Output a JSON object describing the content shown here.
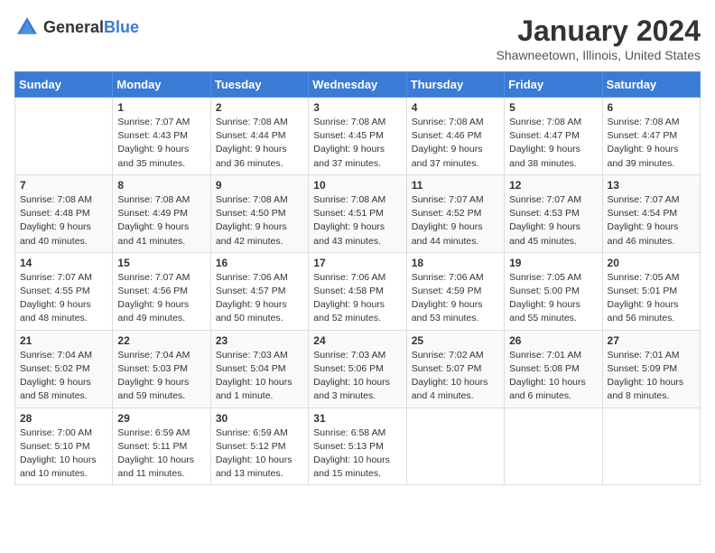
{
  "header": {
    "logo_general": "General",
    "logo_blue": "Blue",
    "title": "January 2024",
    "location": "Shawneetown, Illinois, United States"
  },
  "days_of_week": [
    "Sunday",
    "Monday",
    "Tuesday",
    "Wednesday",
    "Thursday",
    "Friday",
    "Saturday"
  ],
  "weeks": [
    [
      {
        "day": "",
        "info": ""
      },
      {
        "day": "1",
        "info": "Sunrise: 7:07 AM\nSunset: 4:43 PM\nDaylight: 9 hours\nand 35 minutes."
      },
      {
        "day": "2",
        "info": "Sunrise: 7:08 AM\nSunset: 4:44 PM\nDaylight: 9 hours\nand 36 minutes."
      },
      {
        "day": "3",
        "info": "Sunrise: 7:08 AM\nSunset: 4:45 PM\nDaylight: 9 hours\nand 37 minutes."
      },
      {
        "day": "4",
        "info": "Sunrise: 7:08 AM\nSunset: 4:46 PM\nDaylight: 9 hours\nand 37 minutes."
      },
      {
        "day": "5",
        "info": "Sunrise: 7:08 AM\nSunset: 4:47 PM\nDaylight: 9 hours\nand 38 minutes."
      },
      {
        "day": "6",
        "info": "Sunrise: 7:08 AM\nSunset: 4:47 PM\nDaylight: 9 hours\nand 39 minutes."
      }
    ],
    [
      {
        "day": "7",
        "info": "Sunrise: 7:08 AM\nSunset: 4:48 PM\nDaylight: 9 hours\nand 40 minutes."
      },
      {
        "day": "8",
        "info": "Sunrise: 7:08 AM\nSunset: 4:49 PM\nDaylight: 9 hours\nand 41 minutes."
      },
      {
        "day": "9",
        "info": "Sunrise: 7:08 AM\nSunset: 4:50 PM\nDaylight: 9 hours\nand 42 minutes."
      },
      {
        "day": "10",
        "info": "Sunrise: 7:08 AM\nSunset: 4:51 PM\nDaylight: 9 hours\nand 43 minutes."
      },
      {
        "day": "11",
        "info": "Sunrise: 7:07 AM\nSunset: 4:52 PM\nDaylight: 9 hours\nand 44 minutes."
      },
      {
        "day": "12",
        "info": "Sunrise: 7:07 AM\nSunset: 4:53 PM\nDaylight: 9 hours\nand 45 minutes."
      },
      {
        "day": "13",
        "info": "Sunrise: 7:07 AM\nSunset: 4:54 PM\nDaylight: 9 hours\nand 46 minutes."
      }
    ],
    [
      {
        "day": "14",
        "info": "Sunrise: 7:07 AM\nSunset: 4:55 PM\nDaylight: 9 hours\nand 48 minutes."
      },
      {
        "day": "15",
        "info": "Sunrise: 7:07 AM\nSunset: 4:56 PM\nDaylight: 9 hours\nand 49 minutes."
      },
      {
        "day": "16",
        "info": "Sunrise: 7:06 AM\nSunset: 4:57 PM\nDaylight: 9 hours\nand 50 minutes."
      },
      {
        "day": "17",
        "info": "Sunrise: 7:06 AM\nSunset: 4:58 PM\nDaylight: 9 hours\nand 52 minutes."
      },
      {
        "day": "18",
        "info": "Sunrise: 7:06 AM\nSunset: 4:59 PM\nDaylight: 9 hours\nand 53 minutes."
      },
      {
        "day": "19",
        "info": "Sunrise: 7:05 AM\nSunset: 5:00 PM\nDaylight: 9 hours\nand 55 minutes."
      },
      {
        "day": "20",
        "info": "Sunrise: 7:05 AM\nSunset: 5:01 PM\nDaylight: 9 hours\nand 56 minutes."
      }
    ],
    [
      {
        "day": "21",
        "info": "Sunrise: 7:04 AM\nSunset: 5:02 PM\nDaylight: 9 hours\nand 58 minutes."
      },
      {
        "day": "22",
        "info": "Sunrise: 7:04 AM\nSunset: 5:03 PM\nDaylight: 9 hours\nand 59 minutes."
      },
      {
        "day": "23",
        "info": "Sunrise: 7:03 AM\nSunset: 5:04 PM\nDaylight: 10 hours\nand 1 minute."
      },
      {
        "day": "24",
        "info": "Sunrise: 7:03 AM\nSunset: 5:06 PM\nDaylight: 10 hours\nand 3 minutes."
      },
      {
        "day": "25",
        "info": "Sunrise: 7:02 AM\nSunset: 5:07 PM\nDaylight: 10 hours\nand 4 minutes."
      },
      {
        "day": "26",
        "info": "Sunrise: 7:01 AM\nSunset: 5:08 PM\nDaylight: 10 hours\nand 6 minutes."
      },
      {
        "day": "27",
        "info": "Sunrise: 7:01 AM\nSunset: 5:09 PM\nDaylight: 10 hours\nand 8 minutes."
      }
    ],
    [
      {
        "day": "28",
        "info": "Sunrise: 7:00 AM\nSunset: 5:10 PM\nDaylight: 10 hours\nand 10 minutes."
      },
      {
        "day": "29",
        "info": "Sunrise: 6:59 AM\nSunset: 5:11 PM\nDaylight: 10 hours\nand 11 minutes."
      },
      {
        "day": "30",
        "info": "Sunrise: 6:59 AM\nSunset: 5:12 PM\nDaylight: 10 hours\nand 13 minutes."
      },
      {
        "day": "31",
        "info": "Sunrise: 6:58 AM\nSunset: 5:13 PM\nDaylight: 10 hours\nand 15 minutes."
      },
      {
        "day": "",
        "info": ""
      },
      {
        "day": "",
        "info": ""
      },
      {
        "day": "",
        "info": ""
      }
    ]
  ]
}
